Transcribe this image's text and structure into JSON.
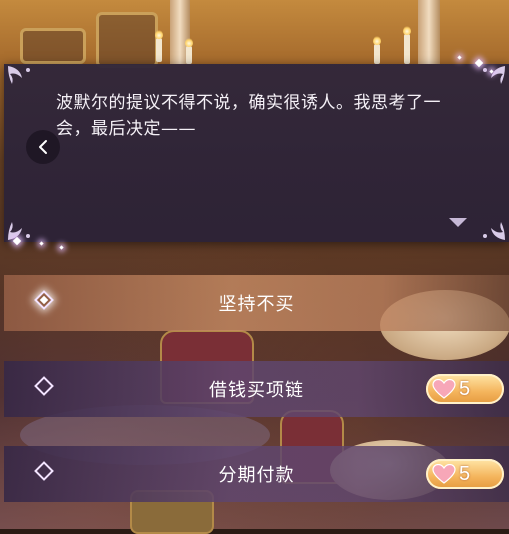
{
  "dialog": {
    "text": "波默尔的提议不得不说，确实很诱人。我思考了一会，最后决定——"
  },
  "choices": [
    {
      "label": "坚持不买",
      "selected": true,
      "cost": null
    },
    {
      "label": "借钱买项链",
      "selected": false,
      "cost": "5"
    },
    {
      "label": "分期付款",
      "selected": false,
      "cost": "5"
    }
  ],
  "colors": {
    "dialog_bg": "#2f2639",
    "selected_choice": "#c88c64",
    "normal_choice": "#5f466e",
    "cost_badge": "#f4b45c",
    "heart": "#f7a7b8"
  },
  "icons": {
    "back": "chevron-left-icon",
    "next": "triangle-down-icon",
    "choice_marker": "diamond-icon",
    "cost": "heart-icon"
  }
}
